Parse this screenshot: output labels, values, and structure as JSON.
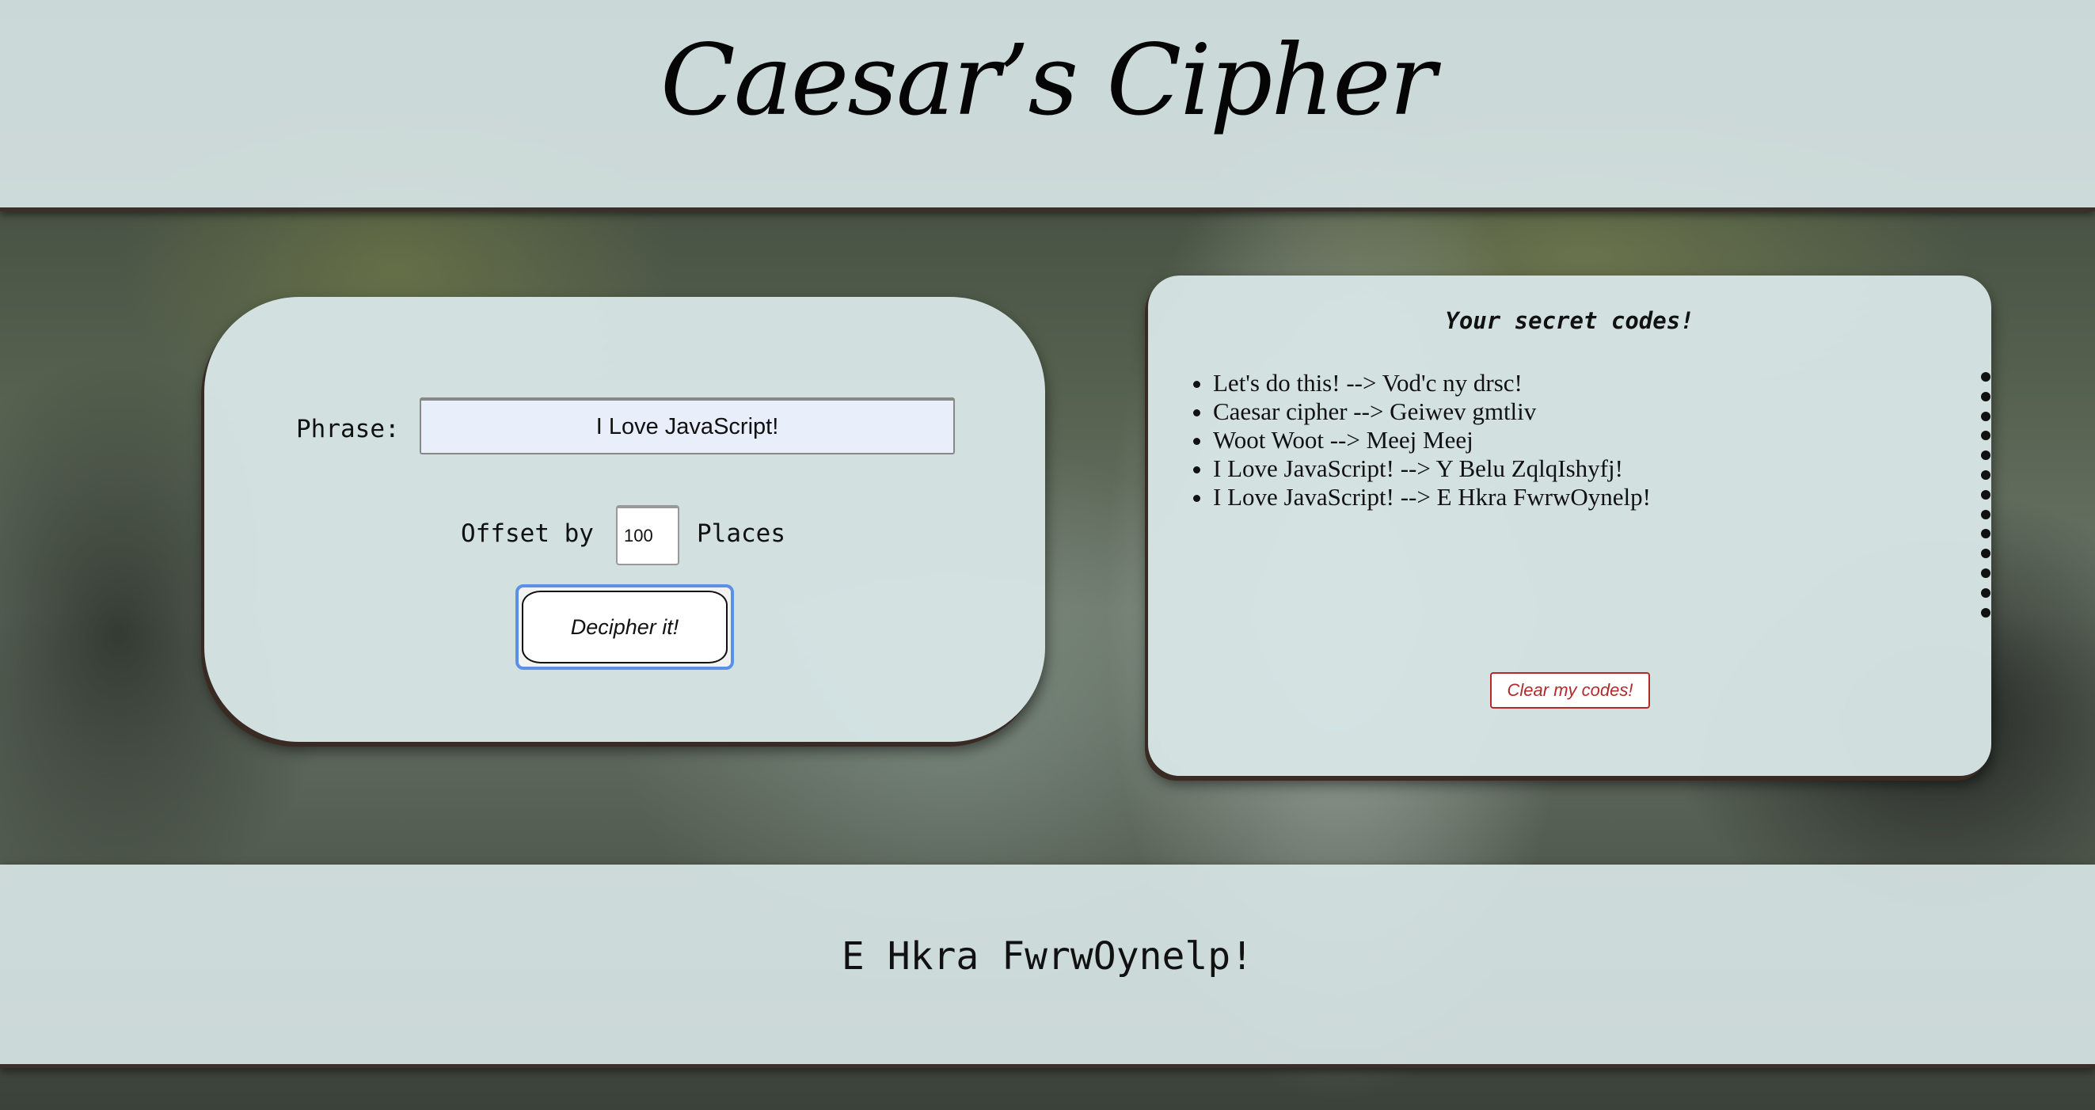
{
  "header": {
    "title": "Caesar’s Cipher"
  },
  "form": {
    "phrase_label": "Phrase:",
    "phrase_value": "I Love JavaScript!",
    "offset_label": "Offset by",
    "offset_value": "100",
    "places_label": "Places",
    "decipher_label": "Decipher it!"
  },
  "codes": {
    "title": "Your secret codes!",
    "items": [
      "Let's do this! --> Vod'c ny drsc!",
      "Caesar cipher --> Geiwev gmtliv",
      "Woot Woot --> Meej Meej",
      "I Love JavaScript! --> Y Belu ZqlqIshyfj!",
      "I Love JavaScript! --> E Hkra FwrwOynelp!"
    ],
    "clear_label": "Clear my codes!"
  },
  "result": {
    "text": "E Hkra FwrwOynelp!"
  },
  "colors": {
    "panel": "#d6e4e4",
    "phrase_input_bg": "#e9eefb",
    "focus_ring": "#5b8fe8",
    "clear_button": "#b22a2a",
    "border_brown": "#3a2f2a"
  }
}
